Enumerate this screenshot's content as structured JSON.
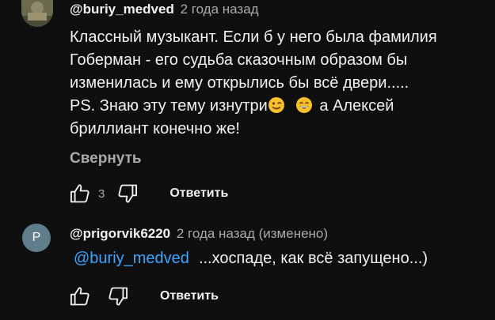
{
  "comments": [
    {
      "author": "@buriy_medved",
      "time": "2 года назад",
      "lines": [
        "Классный музыкант. Если б у него была фамилия",
        "Гоберман - его судьба сказочным образом бы",
        "изменилась и ему открылись бы всё двери.....",
        "PS. Знаю эту тему изнутри",
        "а Алексей",
        "бриллиант конечно же!"
      ],
      "collapse_label": "Свернуть",
      "like_count": "3",
      "reply_label": "Ответить"
    },
    {
      "author": "@prigorvik6220",
      "time": "2 года назад (изменено)",
      "avatar_letter": "P",
      "mention": "@buriy_medved",
      "text": "...хоспаде, как всё запущено...)",
      "reply_label": "Ответить"
    }
  ],
  "icons": [
    "like-icon",
    "dislike-icon",
    "wink-emoji-icon",
    "grin-emoji-icon"
  ],
  "colors": {
    "background": "#0f0f0f",
    "mention": "#3ea6ff",
    "secondary_text": "#aaaaaa",
    "avatar2": "#607d8b"
  }
}
